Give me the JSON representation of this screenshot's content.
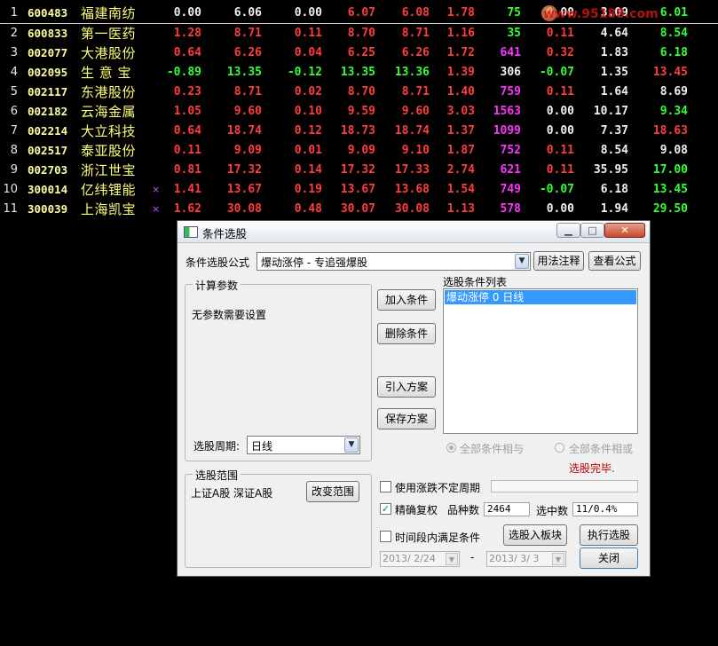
{
  "colors": {
    "rise": "#ff3c3c",
    "fall": "#33ff33",
    "flat": "#f0f0f0",
    "turnover": "#ff33ff",
    "selection": "#3399ff",
    "done_text": "#c00000"
  },
  "watermark": "www.95188.com",
  "stocks": [
    {
      "idx": "1",
      "code": "600483",
      "name": "福建南纺",
      "mark": "",
      "v": [
        "0.00",
        "6.06",
        "0.00",
        "6.07",
        "6.08",
        "1.78",
        "75",
        "0.00",
        "3.09",
        "6.01"
      ],
      "c": [
        "white",
        "white",
        "white",
        "red",
        "red",
        "red",
        "green",
        "white",
        "white",
        "green"
      ]
    },
    {
      "idx": "2",
      "code": "600833",
      "name": "第一医药",
      "mark": "",
      "v": [
        "1.28",
        "8.71",
        "0.11",
        "8.70",
        "8.71",
        "1.16",
        "35",
        "0.11",
        "4.64",
        "8.54"
      ],
      "c": [
        "red",
        "red",
        "red",
        "red",
        "red",
        "red",
        "green",
        "red",
        "white",
        "green"
      ]
    },
    {
      "idx": "3",
      "code": "002077",
      "name": "大港股份",
      "mark": "",
      "v": [
        "0.64",
        "6.26",
        "0.04",
        "6.25",
        "6.26",
        "1.72",
        "641",
        "0.32",
        "1.83",
        "6.18"
      ],
      "c": [
        "red",
        "red",
        "red",
        "red",
        "red",
        "red",
        "mag",
        "red",
        "white",
        "green"
      ]
    },
    {
      "idx": "4",
      "code": "002095",
      "name": "生 意 宝",
      "mark": "",
      "v": [
        "-0.89",
        "13.35",
        "-0.12",
        "13.35",
        "13.36",
        "1.39",
        "306",
        "-0.07",
        "1.35",
        "13.45"
      ],
      "c": [
        "green",
        "green",
        "green",
        "green",
        "green",
        "red",
        "white",
        "green",
        "white",
        "red"
      ]
    },
    {
      "idx": "5",
      "code": "002117",
      "name": "东港股份",
      "mark": "",
      "v": [
        "0.23",
        "8.71",
        "0.02",
        "8.70",
        "8.71",
        "1.40",
        "759",
        "0.11",
        "1.64",
        "8.69"
      ],
      "c": [
        "red",
        "red",
        "red",
        "red",
        "red",
        "red",
        "mag",
        "red",
        "white",
        "white"
      ]
    },
    {
      "idx": "6",
      "code": "002182",
      "name": "云海金属",
      "mark": "",
      "v": [
        "1.05",
        "9.60",
        "0.10",
        "9.59",
        "9.60",
        "3.03",
        "1563",
        "0.00",
        "10.17",
        "9.34"
      ],
      "c": [
        "red",
        "red",
        "red",
        "red",
        "red",
        "red",
        "mag",
        "white",
        "white",
        "green"
      ]
    },
    {
      "idx": "7",
      "code": "002214",
      "name": "大立科技",
      "mark": "",
      "v": [
        "0.64",
        "18.74",
        "0.12",
        "18.73",
        "18.74",
        "1.37",
        "1099",
        "0.00",
        "7.37",
        "18.63"
      ],
      "c": [
        "red",
        "red",
        "red",
        "red",
        "red",
        "red",
        "mag",
        "white",
        "white",
        "red"
      ]
    },
    {
      "idx": "8",
      "code": "002517",
      "name": "泰亚股份",
      "mark": "",
      "v": [
        "0.11",
        "9.09",
        "0.01",
        "9.09",
        "9.10",
        "1.87",
        "752",
        "0.11",
        "8.54",
        "9.08"
      ],
      "c": [
        "red",
        "red",
        "red",
        "red",
        "red",
        "red",
        "mag",
        "red",
        "white",
        "white"
      ]
    },
    {
      "idx": "9",
      "code": "002703",
      "name": "浙江世宝",
      "mark": "",
      "v": [
        "0.81",
        "17.32",
        "0.14",
        "17.32",
        "17.33",
        "2.74",
        "621",
        "0.11",
        "35.95",
        "17.00"
      ],
      "c": [
        "red",
        "red",
        "red",
        "red",
        "red",
        "red",
        "mag",
        "red",
        "white",
        "green"
      ]
    },
    {
      "idx": "10",
      "code": "300014",
      "name": "亿纬锂能",
      "mark": "×",
      "v": [
        "1.41",
        "13.67",
        "0.19",
        "13.67",
        "13.68",
        "1.54",
        "749",
        "-0.07",
        "6.18",
        "13.45"
      ],
      "c": [
        "red",
        "red",
        "red",
        "red",
        "red",
        "red",
        "mag",
        "green",
        "white",
        "green"
      ]
    },
    {
      "idx": "11",
      "code": "300039",
      "name": "上海凯宝",
      "mark": "×",
      "v": [
        "1.62",
        "30.08",
        "0.48",
        "30.07",
        "30.08",
        "1.13",
        "578",
        "0.00",
        "1.94",
        "29.50"
      ],
      "c": [
        "red",
        "red",
        "red",
        "red",
        "red",
        "red",
        "mag",
        "white",
        "white",
        "green"
      ]
    }
  ],
  "dialog": {
    "title": "条件选股",
    "formula_label": "条件选股公式",
    "formula_value": "爆动涨停 - 专追强爆股",
    "usage_button": "用法注释",
    "view_formula_button": "查看公式",
    "params_group": "计算参数",
    "params_text": "无参数需要设置",
    "period_label": "选股周期:",
    "period_value": "日线",
    "add_button": "加入条件",
    "delete_button": "删除条件",
    "import_button": "引入方案",
    "save_button": "保存方案",
    "conditions_label": "选股条件列表",
    "conditions": [
      "爆动涨停  0  日线"
    ],
    "radio_and": "全部条件相与",
    "radio_or": "全部条件相或",
    "status": "选股完毕.",
    "range_group": "选股范围",
    "range_text": "上证A股  深证A股",
    "change_range_button": "改变范围",
    "use_uncertain_period": "使用涨跌不定周期",
    "precise_adjust": "精确复权",
    "count_label": "品种数",
    "count_value": "2464",
    "selected_label": "选中数",
    "selected_value": "11/0.4%",
    "within_period": "时间段内满足条件",
    "to_block_button": "选股入板块",
    "execute_button": "执行选股",
    "date_from": "2013/ 2/24",
    "date_sep": "-",
    "date_to": "2013/ 3/ 3",
    "close_button": "关闭"
  }
}
